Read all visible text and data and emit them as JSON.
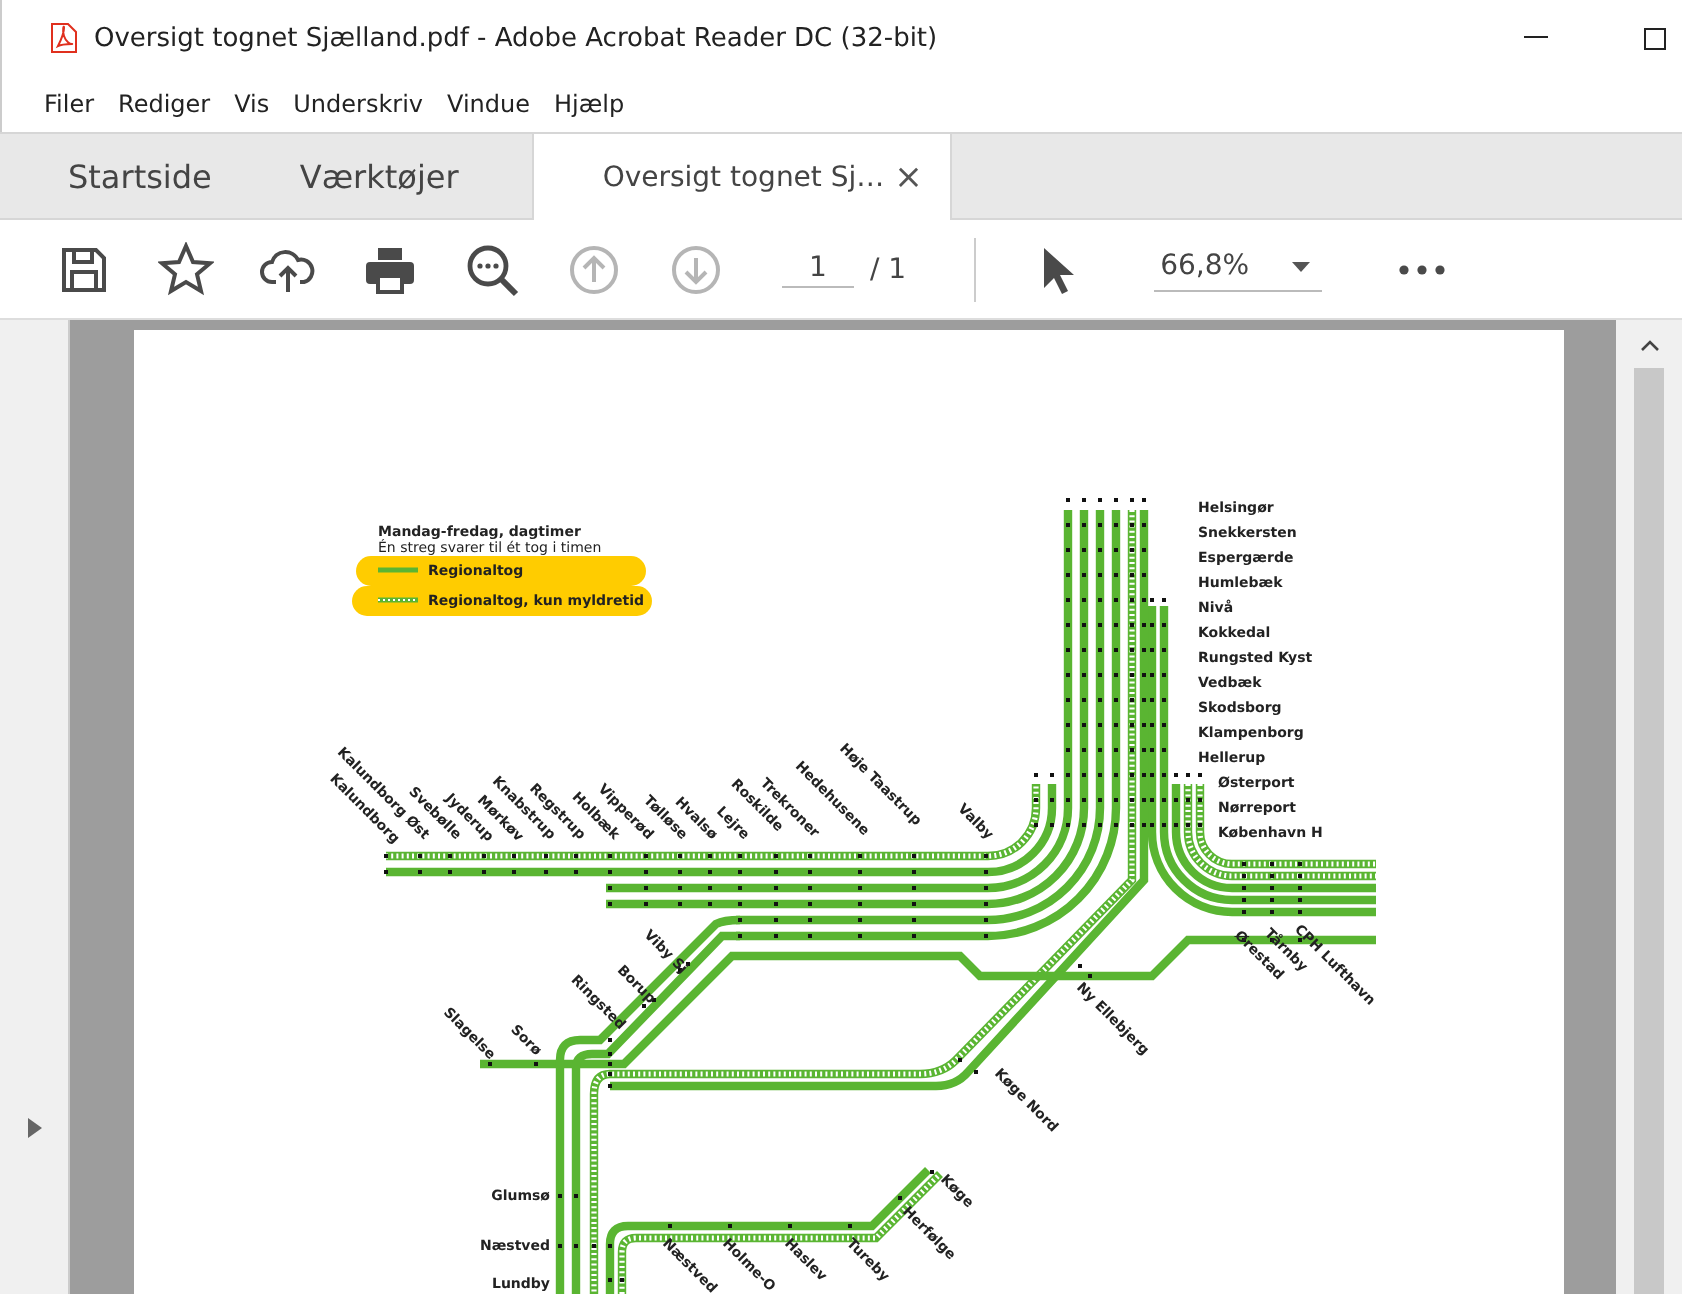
{
  "window": {
    "title": "Oversigt tognet Sjælland.pdf - Adobe Acrobat Reader DC (32-bit)"
  },
  "menu": [
    "Filer",
    "Rediger",
    "Vis",
    "Underskriv",
    "Vindue",
    "Hjælp"
  ],
  "tabs": [
    {
      "label": "Startside",
      "selected": false
    },
    {
      "label": "Værktøjer",
      "selected": false
    },
    {
      "label": "Oversigt tognet Sj…",
      "selected": true,
      "close": "×"
    }
  ],
  "toolbar": {
    "page": "1",
    "page_total": "/ 1",
    "zoom": "66,8%",
    "previous_disabled": true,
    "next_disabled": true
  },
  "document": {
    "legend": {
      "title": "Mandag-fredag, dagtimer",
      "note": "Én streg svarer til ét tog i timen",
      "items": [
        {
          "label": "Regionaltog",
          "kind": "solid"
        },
        {
          "label": "Regionaltog, kun myldretid",
          "kind": "dashed"
        }
      ]
    },
    "stations": [
      "Kalundborg",
      "Kalundborg Øst",
      "Svebølle",
      "Jyderup",
      "Mørkøv",
      "Knabstrup",
      "Regstrup",
      "Holbæk",
      "Vipperød",
      "Tølløse",
      "Hvalsø",
      "Lejre",
      "Roskilde",
      "Trekroner",
      "Hedehusene",
      "Høje Taastrup",
      "Valby",
      "Helsingør",
      "Snekkersten",
      "Espergærde",
      "Humlebæk",
      "Nivå",
      "Kokkedal",
      "Rungsted Kyst",
      "Vedbæk",
      "Skodsborg",
      "Klampenborg",
      "Hellerup",
      "Østerport",
      "Nørreport",
      "København H",
      "Ørestad",
      "Tårnby",
      "CPH Lufthavn",
      "Ny Ellebjerg",
      "Køge Nord",
      "Viby Sj",
      "Borup",
      "Ringsted",
      "Slagelse",
      "Sorø",
      "Glumsø",
      "Næstved",
      "Lundby",
      "Køge",
      "Herfølge",
      "Næstved",
      "Holme-O",
      "Haslev",
      "Tureby"
    ]
  }
}
